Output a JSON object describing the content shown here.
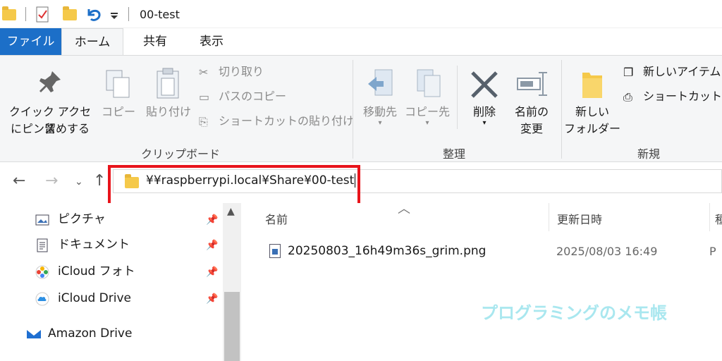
{
  "window": {
    "title": "00-test"
  },
  "tabs": {
    "file": "ファイル",
    "home": "ホーム",
    "share": "共有",
    "view": "表示"
  },
  "ribbon": {
    "clipboard": {
      "pin_line1": "クイック アクセス",
      "pin_line2": "にピン留めする",
      "copy": "コピー",
      "paste": "貼り付け",
      "cut": "切り取り",
      "copy_path": "パスのコピー",
      "paste_shortcut": "ショートカットの貼り付け",
      "label": "クリップボード"
    },
    "organize": {
      "move_to": "移動先",
      "copy_to": "コピー先",
      "delete": "削除",
      "rename_line1": "名前の",
      "rename_line2": "変更",
      "label": "整理"
    },
    "new": {
      "folder_line1": "新しい",
      "folder_line2": "フォルダー",
      "new_item": "新しいアイテム",
      "shortcut": "ショートカット ▾",
      "label": "新規"
    }
  },
  "address": {
    "path": "¥¥raspberrypi.local¥Share¥00-test"
  },
  "nav_pane": {
    "items": [
      {
        "label": "ピクチャ",
        "icon": "pictures-icon"
      },
      {
        "label": "ドキュメント",
        "icon": "documents-icon"
      },
      {
        "label": "iCloud フォト",
        "icon": "icloud-photos-icon"
      },
      {
        "label": "iCloud Drive",
        "icon": "icloud-drive-icon"
      },
      {
        "label": "Amazon Drive",
        "icon": "amazon-drive-icon"
      }
    ]
  },
  "file_list": {
    "columns": {
      "name": "名前",
      "modified": "更新日時",
      "type": "種"
    },
    "rows": [
      {
        "name": "20250803_16h49m36s_grim.png",
        "modified": "2025/08/03 16:49",
        "type": "P"
      }
    ]
  },
  "watermark": "プログラミングのメモ帳",
  "colors": {
    "file_tab": "#1c6fc8",
    "highlight": "#e8141b",
    "folder": "#f5c94a",
    "watermark": "#a9e7ef"
  }
}
